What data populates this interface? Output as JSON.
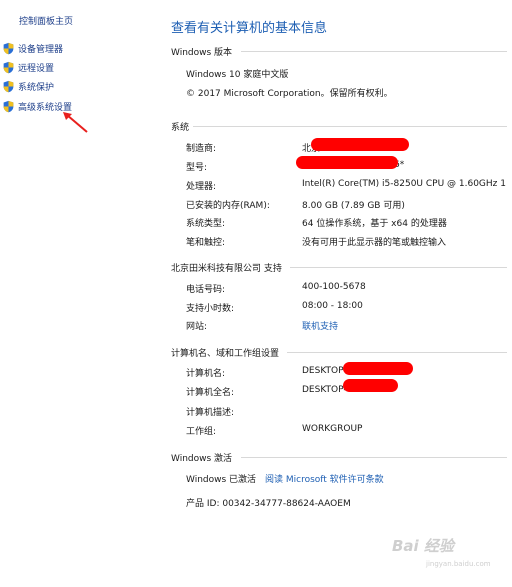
{
  "sidebar": {
    "home": "控制面板主页",
    "items": [
      {
        "label": "设备管理器",
        "icon": "shield-icon"
      },
      {
        "label": "远程设置",
        "icon": "shield-icon"
      },
      {
        "label": "系统保护",
        "icon": "shield-icon"
      },
      {
        "label": "高级系统设置",
        "icon": "shield-icon"
      }
    ]
  },
  "main": {
    "title": "查看有关计算机的基本信息",
    "windows_edition": {
      "heading": "Windows 版本",
      "edition": "Windows 10 家庭中文版",
      "copyright": "© 2017 Microsoft Corporation。保留所有权利。"
    },
    "system": {
      "heading": "系统",
      "rows": [
        {
          "label": "制造商:",
          "value": "北京"
        },
        {
          "label": "型号:",
          "value": "6*"
        },
        {
          "label": "处理器:",
          "value": "Intel(R) Core(TM) i5-8250U CPU @ 1.60GHz   1"
        },
        {
          "label": "已安装的内存(RAM):",
          "value": "8.00 GB (7.89 GB 可用)"
        },
        {
          "label": "系统类型:",
          "value": "64 位操作系统，基于 x64 的处理器"
        },
        {
          "label": "笔和触控:",
          "value": "没有可用于此显示器的笔或触控输入"
        }
      ]
    },
    "support": {
      "heading": "北京田米科技有限公司 支持",
      "rows": [
        {
          "label": "电话号码:",
          "value": "400-100-5678"
        },
        {
          "label": "支持小时数:",
          "value": "08:00 - 18:00"
        },
        {
          "label": "网站:",
          "value": "联机支持"
        }
      ]
    },
    "computer_name": {
      "heading": "计算机名、域和工作组设置",
      "rows": [
        {
          "label": "计算机名:",
          "value": "DESKTOP"
        },
        {
          "label": "计算机全名:",
          "value": "DESKTOP-     7ODMS"
        },
        {
          "label": "计算机描述:",
          "value": ""
        },
        {
          "label": "工作组:",
          "value": "WORKGROUP"
        }
      ]
    },
    "activation": {
      "heading": "Windows 激活",
      "status": "Windows 已激活",
      "license_link": "阅读 Microsoft 软件许可条款",
      "product_id": "产品 ID: 00342-34777-88624-AAOEM"
    }
  },
  "watermark": {
    "text": "Bai 经验",
    "sub": "jingyan.baidu.com"
  },
  "colors": {
    "link": "#1e5fb3",
    "sidebar_link": "#1e3f8a",
    "annotation": "#e8201e",
    "redaction": "#ff0000"
  }
}
